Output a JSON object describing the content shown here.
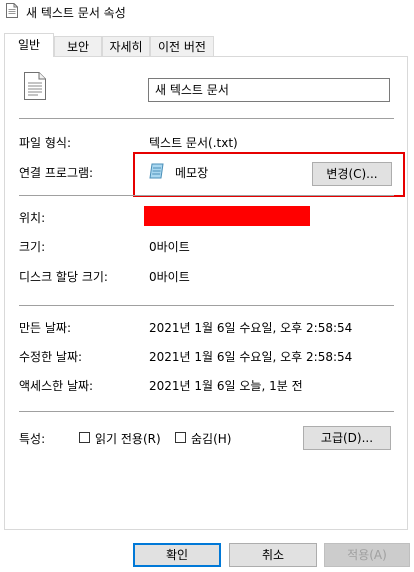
{
  "window": {
    "title": "새 텍스트 문서 속성",
    "file_icon": "text-document-icon"
  },
  "tabs": [
    {
      "label": "일반",
      "active": true
    },
    {
      "label": "보안",
      "active": false
    },
    {
      "label": "자세히",
      "active": false
    },
    {
      "label": "이전 버전",
      "active": false
    }
  ],
  "general": {
    "file_name": "새 텍스트 문서",
    "file_type_label": "파일 형식:",
    "file_type_value": "텍스트 문서(.txt)",
    "opens_with_label": "연결 프로그램:",
    "opens_with_app": "메모장",
    "opens_with_app_icon": "notepad-icon",
    "change_button": "변경(C)...",
    "location_label": "위치:",
    "size_label": "크기:",
    "size_value": "0바이트",
    "size_on_disk_label": "디스크 할당 크기:",
    "size_on_disk_value": "0바이트",
    "created_label": "만든 날짜:",
    "created_value": "2021년 1월 6일 수요일, 오후 2:58:54",
    "modified_label": "수정한 날짜:",
    "modified_value": "2021년 1월 6일 수요일, 오후 2:58:54",
    "accessed_label": "액세스한 날짜:",
    "accessed_value": "2021년 1월 6일 오늘, 1분 전",
    "attributes_label": "특성:",
    "readonly_label": "읽기 전용(R)",
    "readonly_checked": false,
    "hidden_label": "숨김(H)",
    "hidden_checked": false,
    "advanced_button": "고급(D)..."
  },
  "footer": {
    "ok_button": "확인",
    "cancel_button": "취소",
    "apply_button": "적용(A)",
    "apply_enabled": false
  },
  "colors": {
    "highlight_border": "#e60000",
    "redaction": "#ff0000",
    "accent": "#0078d7"
  }
}
